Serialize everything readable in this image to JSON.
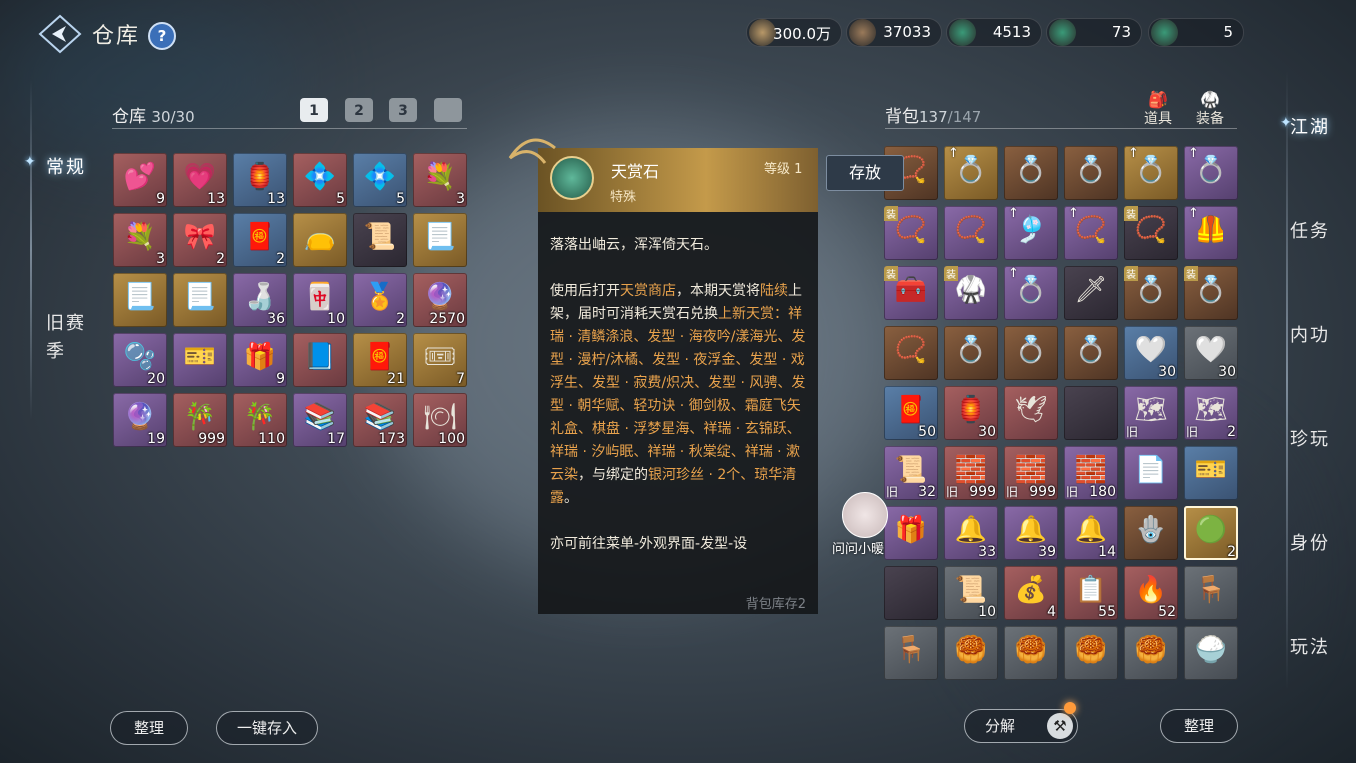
{
  "header": {
    "title": "仓库",
    "help": "?"
  },
  "currencies": [
    {
      "icon": "scroll-coin-icon",
      "value": "300.0万"
    },
    {
      "icon": "bronze-coin-icon",
      "value": "37033"
    },
    {
      "icon": "jade-coin-icon",
      "value": "4513"
    },
    {
      "icon": "jade-coin-icon",
      "value": "73"
    },
    {
      "icon": "jade-ring-icon",
      "value": "5"
    }
  ],
  "left_nav": [
    {
      "label": "常规",
      "active": true
    },
    {
      "label": "旧赛季",
      "active": false
    }
  ],
  "right_nav": [
    {
      "label": "江湖",
      "active": true
    },
    {
      "label": "任务",
      "active": false
    },
    {
      "label": "内功",
      "active": false
    },
    {
      "label": "珍玩",
      "active": false
    },
    {
      "label": "身份",
      "active": false
    },
    {
      "label": "玩法",
      "active": false
    }
  ],
  "warehouse": {
    "label": "仓库",
    "count": "30/30",
    "tabs": [
      "1",
      "2",
      "3",
      ""
    ],
    "buttons": {
      "sort": "整理",
      "deposit_all": "一键存入"
    }
  },
  "backpack": {
    "label": "背包",
    "count_main": "137",
    "count_total": "/147",
    "tabs": [
      {
        "label": "道具",
        "icon": "bag-icon"
      },
      {
        "label": "装备",
        "icon": "armor-icon"
      }
    ],
    "buttons": {
      "decompose": "分解",
      "sort": "整理"
    }
  },
  "tooltip": {
    "name": "天赏石",
    "level_label": "等级 1",
    "type": "特殊",
    "store_button": "存放",
    "line1": "落落出岫云，浑浑倚天石。",
    "p2_a": "使用后打开",
    "p2_shop": "天赏商店",
    "p2_b": "，本期天赏将",
    "p2_c": "陆续",
    "p2_d": "上架，届时可消耗天赏石兑换",
    "p2_list": "上新天赏：祥瑞 · 清鳞涤浪、发型 · 海夜吟/漾海光、发型 · 漫柠/沐橘、发型 · 夜浮金、发型 · 戏浮生、发型 · 寂费/炽决、发型 · 风骋、发型 · 朝华赋、轻功诀 · 御剑极、霜庭飞矢礼盒、棋盘 · 浮梦星海、祥瑞 · 玄锦跃、祥瑞 · 汐屿眠、祥瑞 · 秋棠绽、祥瑞 · 漱云染",
    "p2_e": "，与绑定的",
    "p2_f": "银河珍丝 · 2个、琼华清露",
    "p2_g": "。",
    "p3": "亦可前往菜单-外观界面-发型-设",
    "footer": "背包库存2"
  },
  "npc": {
    "label": "问问小暖"
  },
  "warehouse_items": [
    {
      "icon": "heart-icon",
      "g": "💕",
      "q": "red",
      "n": "9"
    },
    {
      "icon": "hearts-icon",
      "g": "💗",
      "q": "red",
      "n": "13"
    },
    {
      "icon": "lantern-icon",
      "g": "🏮",
      "q": "blue",
      "n": "13"
    },
    {
      "icon": "crystal-icon",
      "g": "💠",
      "q": "red",
      "n": "5"
    },
    {
      "icon": "crystal-icon",
      "g": "💠",
      "q": "blue",
      "n": "5"
    },
    {
      "icon": "rose-bouquet-icon",
      "g": "💐",
      "q": "red",
      "n": "3"
    },
    {
      "icon": "rose-bouquet-icon",
      "g": "💐",
      "q": "red",
      "n": "3"
    },
    {
      "icon": "knot-icon",
      "g": "🎀",
      "q": "red",
      "n": "2"
    },
    {
      "icon": "fu-charm-icon",
      "g": "🧧",
      "q": "blue",
      "n": "2"
    },
    {
      "icon": "pouch-icon",
      "g": "👝",
      "q": "gold",
      "n": ""
    },
    {
      "icon": "scroll-icon",
      "g": "📜",
      "q": "dark",
      "n": ""
    },
    {
      "icon": "letter-icon",
      "g": "📃",
      "q": "gold",
      "n": ""
    },
    {
      "icon": "letter-icon",
      "g": "📃",
      "q": "gold",
      "n": ""
    },
    {
      "icon": "letter-icon",
      "g": "📃",
      "q": "gold",
      "n": ""
    },
    {
      "icon": "bottle-icon",
      "g": "🍶",
      "q": "purple",
      "n": "36"
    },
    {
      "icon": "seal-icon",
      "g": "🀄",
      "q": "purple",
      "n": "10"
    },
    {
      "icon": "medal-icon",
      "g": "🏅",
      "q": "purple",
      "n": "2"
    },
    {
      "icon": "pink-orb-icon",
      "g": "🔮",
      "q": "red",
      "n": "2570"
    },
    {
      "icon": "pearl-icon",
      "g": "🫧",
      "q": "purple",
      "n": "20"
    },
    {
      "icon": "ticket-icon",
      "g": "🎫",
      "q": "purple",
      "n": ""
    },
    {
      "icon": "gift-box-icon",
      "g": "🎁",
      "q": "purple",
      "n": "9"
    },
    {
      "icon": "book-icon",
      "g": "📘",
      "q": "red",
      "n": ""
    },
    {
      "icon": "red-envelope-icon",
      "g": "🧧",
      "q": "gold",
      "n": "21"
    },
    {
      "icon": "coupon-icon",
      "g": "🎟",
      "q": "gold",
      "n": "7"
    },
    {
      "icon": "pink-pearl-icon",
      "g": "🔮",
      "q": "purple",
      "n": "19"
    },
    {
      "icon": "gourd-icon",
      "g": "🎋",
      "q": "red",
      "n": "999"
    },
    {
      "icon": "gourd-icon",
      "g": "🎋",
      "q": "red",
      "n": "110"
    },
    {
      "icon": "book-stack-icon",
      "g": "📚",
      "q": "purple",
      "n": "17"
    },
    {
      "icon": "book-stack-icon",
      "g": "📚",
      "q": "red",
      "n": "173"
    },
    {
      "icon": "plate-icon",
      "g": "🍽",
      "q": "red",
      "n": "100"
    }
  ],
  "bag_items": [
    {
      "icon": "bracelet-icon",
      "g": "📿",
      "q": "bronze",
      "n": "",
      "mark": ""
    },
    {
      "icon": "ring-icon",
      "g": "💍",
      "q": "gold",
      "n": "",
      "mark": "↑"
    },
    {
      "icon": "ring-icon",
      "g": "💍",
      "q": "bronze",
      "n": "",
      "mark": ""
    },
    {
      "icon": "ring-icon",
      "g": "💍",
      "q": "bronze",
      "n": "",
      "mark": ""
    },
    {
      "icon": "ring-icon",
      "g": "💍",
      "q": "gold",
      "n": "",
      "mark": "↑"
    },
    {
      "icon": "ring-icon",
      "g": "💍",
      "q": "purple",
      "n": "",
      "mark": "↑"
    },
    {
      "icon": "necklace-icon",
      "g": "📿",
      "q": "purple",
      "n": "",
      "mark": "装"
    },
    {
      "icon": "necklace-icon",
      "g": "📿",
      "q": "purple",
      "n": "",
      "mark": ""
    },
    {
      "icon": "hairpin-icon",
      "g": "🎐",
      "q": "purple",
      "n": "",
      "mark": "↑"
    },
    {
      "icon": "necklace-icon",
      "g": "📿",
      "q": "purple",
      "n": "",
      "mark": "↑"
    },
    {
      "icon": "necklace-icon",
      "g": "📿",
      "q": "dark",
      "n": "",
      "mark": "装"
    },
    {
      "icon": "armor-piece-icon",
      "g": "🦺",
      "q": "purple",
      "n": "",
      "mark": "↑"
    },
    {
      "icon": "belt-icon",
      "g": "🧰",
      "q": "purple",
      "n": "",
      "mark": "装"
    },
    {
      "icon": "bracer-icon",
      "g": "🥋",
      "q": "purple",
      "n": "",
      "mark": "装"
    },
    {
      "icon": "jade-ring-icon",
      "g": "💍",
      "q": "purple",
      "n": "",
      "mark": "↑"
    },
    {
      "icon": "sword-icon",
      "g": "🗡",
      "q": "dark",
      "n": "",
      "mark": ""
    },
    {
      "icon": "ring-icon",
      "g": "💍",
      "q": "bronze",
      "n": "",
      "mark": "装"
    },
    {
      "icon": "ring-icon",
      "g": "💍",
      "q": "bronze",
      "n": "",
      "mark": "装"
    },
    {
      "icon": "bracelet-icon",
      "g": "📿",
      "q": "bronze",
      "n": "",
      "mark": ""
    },
    {
      "icon": "ring-icon",
      "g": "💍",
      "q": "bronze",
      "n": "",
      "mark": ""
    },
    {
      "icon": "ring-icon",
      "g": "💍",
      "q": "bronze",
      "n": "",
      "mark": ""
    },
    {
      "icon": "ring-icon",
      "g": "💍",
      "q": "bronze",
      "n": "",
      "mark": ""
    },
    {
      "icon": "heart-charm-icon",
      "g": "🤍",
      "q": "blue",
      "n": "30",
      "mark": ""
    },
    {
      "icon": "heart-charm-icon",
      "g": "🤍",
      "q": "grey",
      "n": "30",
      "mark": ""
    },
    {
      "icon": "red-envelope-icon",
      "g": "🧧",
      "q": "blue",
      "n": "50",
      "mark": ""
    },
    {
      "icon": "red-lantern-icon",
      "g": "🏮",
      "q": "red",
      "n": "30",
      "mark": ""
    },
    {
      "icon": "bird-icon",
      "g": "🕊",
      "q": "red",
      "n": "",
      "mark": ""
    },
    {
      "icon": "empty-slot",
      "g": "",
      "q": "dark",
      "n": "",
      "mark": ""
    },
    {
      "icon": "map-icon",
      "g": "🗺",
      "q": "purple",
      "n": "",
      "mark": "旧"
    },
    {
      "icon": "map-icon",
      "g": "🗺",
      "q": "purple",
      "n": "2",
      "mark": "旧"
    },
    {
      "icon": "scroll-icon",
      "g": "📜",
      "q": "purple",
      "n": "32",
      "mark": "旧"
    },
    {
      "icon": "seal-box-icon",
      "g": "🧱",
      "q": "red",
      "n": "999",
      "mark": "旧"
    },
    {
      "icon": "seal-box-icon",
      "g": "🧱",
      "q": "red",
      "n": "999",
      "mark": "旧"
    },
    {
      "icon": "seal-box-icon",
      "g": "🧱",
      "q": "purple",
      "n": "180",
      "mark": "旧"
    },
    {
      "icon": "paper-icon",
      "g": "📄",
      "q": "purple",
      "n": "",
      "mark": ""
    },
    {
      "icon": "blue-ticket-icon",
      "g": "🎫",
      "q": "blue",
      "n": "",
      "mark": ""
    },
    {
      "icon": "blue-bundle-icon",
      "g": "🎁",
      "q": "purple",
      "n": "",
      "mark": ""
    },
    {
      "icon": "gold-bell-icon",
      "g": "🔔",
      "q": "purple",
      "n": "33",
      "mark": ""
    },
    {
      "icon": "red-bell-icon",
      "g": "🔔",
      "q": "purple",
      "n": "39",
      "mark": ""
    },
    {
      "icon": "blue-bell-icon",
      "g": "🔔",
      "q": "purple",
      "n": "14",
      "mark": ""
    },
    {
      "icon": "talisman-icon",
      "g": "🪬",
      "q": "bronze",
      "n": "",
      "mark": ""
    },
    {
      "icon": "jade-stone-icon",
      "g": "🟢",
      "q": "gold",
      "n": "2",
      "mark": ""
    },
    {
      "icon": "empty-slot",
      "g": "",
      "q": "dark",
      "n": "",
      "mark": ""
    },
    {
      "icon": "scroll-roll-icon",
      "g": "📜",
      "q": "grey",
      "n": "10",
      "mark": ""
    },
    {
      "icon": "pouch-icon",
      "g": "💰",
      "q": "red",
      "n": "4",
      "mark": ""
    },
    {
      "icon": "blue-paper-icon",
      "g": "📋",
      "q": "red",
      "n": "55",
      "mark": ""
    },
    {
      "icon": "fire-crate-icon",
      "g": "🔥",
      "q": "red",
      "n": "52",
      "mark": ""
    },
    {
      "icon": "table-set-icon",
      "g": "🪑",
      "q": "grey",
      "n": "",
      "mark": ""
    },
    {
      "icon": "table-icon",
      "g": "🪑",
      "q": "grey",
      "n": "",
      "mark": ""
    },
    {
      "icon": "dish-icon",
      "g": "🥮",
      "q": "grey",
      "n": "",
      "mark": ""
    },
    {
      "icon": "dish-icon",
      "g": "🥮",
      "q": "grey",
      "n": "",
      "mark": ""
    },
    {
      "icon": "dish-icon",
      "g": "🥮",
      "q": "grey",
      "n": "",
      "mark": ""
    },
    {
      "icon": "dish-icon",
      "g": "🥮",
      "q": "grey",
      "n": "",
      "mark": ""
    },
    {
      "icon": "bowl-icon",
      "g": "🍚",
      "q": "grey",
      "n": "",
      "mark": ""
    }
  ]
}
